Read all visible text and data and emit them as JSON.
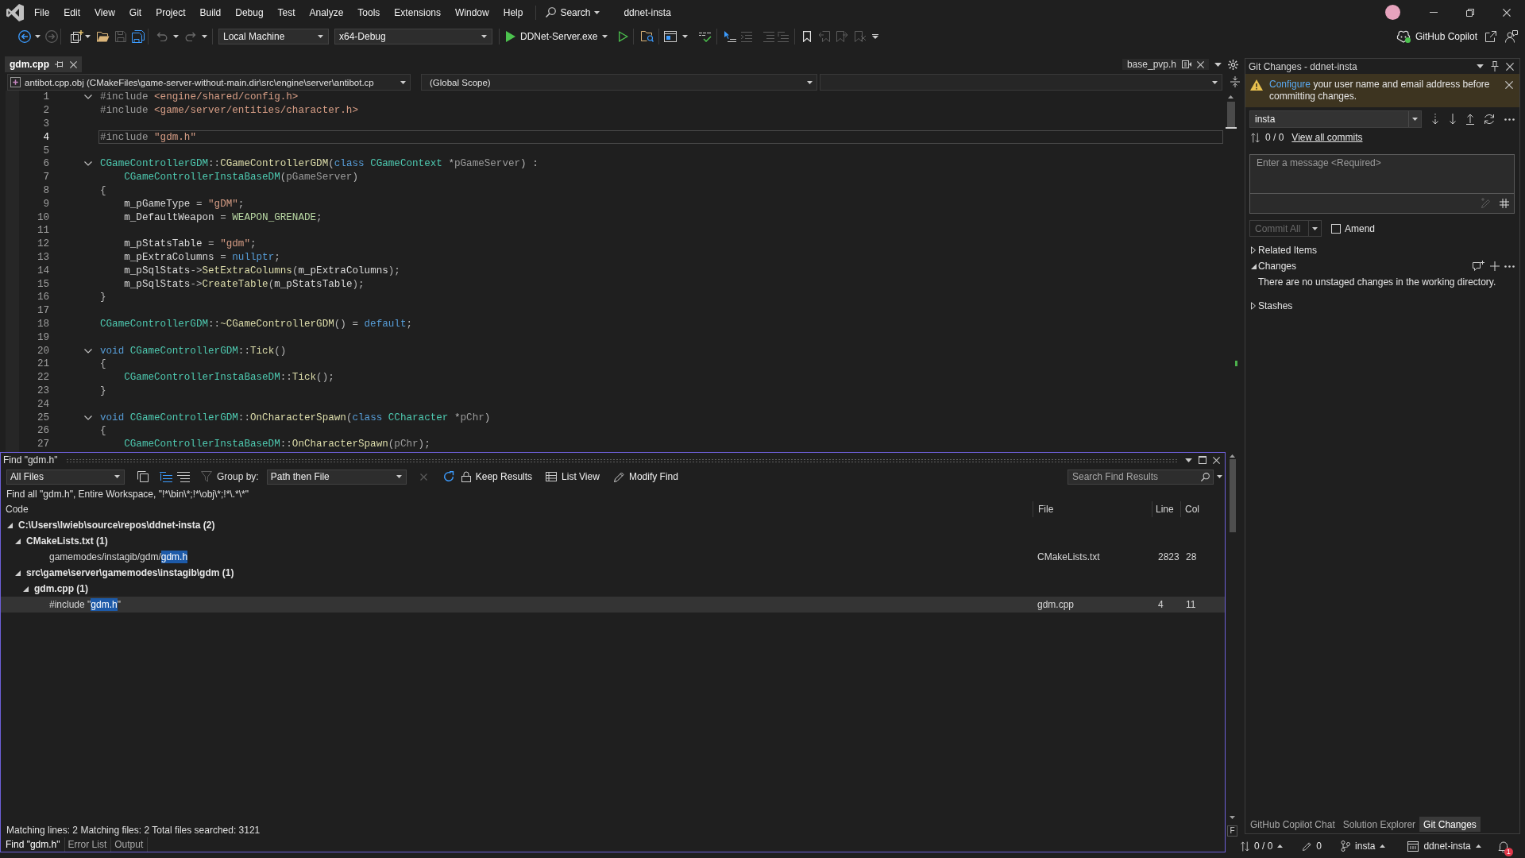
{
  "menu_bar": {
    "items": [
      "File",
      "Edit",
      "View",
      "Git",
      "Project",
      "Build",
      "Debug",
      "Test",
      "Analyze",
      "Tools",
      "Extensions",
      "Window",
      "Help"
    ],
    "search": "Search",
    "solution": "ddnet-insta"
  },
  "toolbar": {
    "target": "Local Machine",
    "configuration": "x64-Debug",
    "startup_item": "DDNet-Server.exe",
    "copilot": "GitHub Copilot"
  },
  "document_tabs": [
    {
      "label": "gdm.cpp",
      "kind": "open",
      "selected": true
    },
    {
      "label": "base_pvp.h",
      "kind": "preview",
      "selected": false
    }
  ],
  "navigation_bar": {
    "project": "antibot.cpp.obj (CMakeFiles\\game-server-without-main.dir\\src\\engine\\server\\antibot.cp",
    "scope": "(Global Scope)"
  },
  "editor": {
    "lines": [
      {
        "number": "1",
        "foldable": true,
        "current": false,
        "tokens": [
          {
            "kind": "pre",
            "text": "#include "
          },
          {
            "kind": "inc",
            "text": "<engine/shared/config.h>"
          }
        ]
      },
      {
        "number": "2",
        "foldable": false,
        "current": false,
        "tokens": [
          {
            "kind": "pre",
            "text": "#include "
          },
          {
            "kind": "inc",
            "text": "<game/server/entities/character.h>"
          }
        ]
      },
      {
        "number": "3",
        "foldable": false,
        "current": false
      },
      {
        "number": "4",
        "foldable": false,
        "current": true,
        "tokens": [
          {
            "kind": "pre",
            "text": "#include "
          },
          {
            "kind": "str",
            "text": "\"gdm.h\""
          }
        ]
      },
      {
        "number": "5",
        "foldable": false,
        "current": false
      },
      {
        "number": "6",
        "foldable": true,
        "current": false,
        "tokens": [
          {
            "kind": "type",
            "text": "CGameControllerGDM"
          },
          {
            "kind": "op",
            "text": "::"
          },
          {
            "kind": "fn",
            "text": "CGameControllerGDM"
          },
          {
            "kind": "op",
            "text": "("
          },
          {
            "kind": "kw",
            "text": "class "
          },
          {
            "kind": "type",
            "text": "CGameContext"
          },
          {
            "kind": "op",
            "text": " *"
          },
          {
            "kind": "param",
            "text": "pGameServer"
          },
          {
            "kind": "op",
            "text": ") :"
          }
        ]
      },
      {
        "number": "7",
        "foldable": false,
        "current": false,
        "tokens": [
          {
            "kind": "type",
            "text": "    CGameControllerInstaBaseDM"
          },
          {
            "kind": "op",
            "text": "("
          },
          {
            "kind": "param",
            "text": "pGameServer"
          },
          {
            "kind": "op",
            "text": ")"
          }
        ]
      },
      {
        "number": "8",
        "foldable": false,
        "current": false,
        "tokens": [
          {
            "kind": "op",
            "text": "{"
          }
        ]
      },
      {
        "number": "9",
        "foldable": false,
        "current": false,
        "tokens": [
          {
            "kind": "var",
            "text": "    m_pGameType"
          },
          {
            "kind": "op",
            "text": " = "
          },
          {
            "kind": "str",
            "text": "\"gDM\""
          },
          {
            "kind": "op",
            "text": ";"
          }
        ]
      },
      {
        "number": "10",
        "foldable": false,
        "current": false,
        "tokens": [
          {
            "kind": "var",
            "text": "    m_DefaultWeapon"
          },
          {
            "kind": "op",
            "text": " = "
          },
          {
            "kind": "enum",
            "text": "WEAPON_GRENADE"
          },
          {
            "kind": "op",
            "text": ";"
          }
        ]
      },
      {
        "number": "11",
        "foldable": false,
        "current": false
      },
      {
        "number": "12",
        "foldable": false,
        "current": false,
        "tokens": [
          {
            "kind": "var",
            "text": "    m_pStatsTable"
          },
          {
            "kind": "op",
            "text": " = "
          },
          {
            "kind": "str",
            "text": "\"gdm\""
          },
          {
            "kind": "op",
            "text": ";"
          }
        ]
      },
      {
        "number": "13",
        "foldable": false,
        "current": false,
        "tokens": [
          {
            "kind": "var",
            "text": "    m_pExtraColumns"
          },
          {
            "kind": "op",
            "text": " = "
          },
          {
            "kind": "kw",
            "text": "nullptr"
          },
          {
            "kind": "op",
            "text": ";"
          }
        ]
      },
      {
        "number": "14",
        "foldable": false,
        "current": false,
        "tokens": [
          {
            "kind": "var",
            "text": "    m_pSqlStats"
          },
          {
            "kind": "op",
            "text": "->"
          },
          {
            "kind": "fn",
            "text": "SetExtraColumns"
          },
          {
            "kind": "op",
            "text": "("
          },
          {
            "kind": "var",
            "text": "m_pExtraColumns"
          },
          {
            "kind": "op",
            "text": ");"
          }
        ]
      },
      {
        "number": "15",
        "foldable": false,
        "current": false,
        "tokens": [
          {
            "kind": "var",
            "text": "    m_pSqlStats"
          },
          {
            "kind": "op",
            "text": "->"
          },
          {
            "kind": "fn",
            "text": "CreateTable"
          },
          {
            "kind": "op",
            "text": "("
          },
          {
            "kind": "var",
            "text": "m_pStatsTable"
          },
          {
            "kind": "op",
            "text": ");"
          }
        ]
      },
      {
        "number": "16",
        "foldable": false,
        "current": false,
        "tokens": [
          {
            "kind": "op",
            "text": "}"
          }
        ]
      },
      {
        "number": "17",
        "foldable": false,
        "current": false
      },
      {
        "number": "18",
        "foldable": false,
        "current": false,
        "tokens": [
          {
            "kind": "type",
            "text": "CGameControllerGDM"
          },
          {
            "kind": "op",
            "text": "::"
          },
          {
            "kind": "fn",
            "text": "~CGameControllerGDM"
          },
          {
            "kind": "op",
            "text": "() = "
          },
          {
            "kind": "kw",
            "text": "default"
          },
          {
            "kind": "op",
            "text": ";"
          }
        ]
      },
      {
        "number": "19",
        "foldable": false,
        "current": false
      },
      {
        "number": "20",
        "foldable": true,
        "current": false,
        "tokens": [
          {
            "kind": "kw",
            "text": "void "
          },
          {
            "kind": "type",
            "text": "CGameControllerGDM"
          },
          {
            "kind": "op",
            "text": "::"
          },
          {
            "kind": "fn",
            "text": "Tick"
          },
          {
            "kind": "op",
            "text": "()"
          }
        ]
      },
      {
        "number": "21",
        "foldable": false,
        "current": false,
        "tokens": [
          {
            "kind": "op",
            "text": "{"
          }
        ]
      },
      {
        "number": "22",
        "foldable": false,
        "current": false,
        "tokens": [
          {
            "kind": "type",
            "text": "    CGameControllerInstaBaseDM"
          },
          {
            "kind": "op",
            "text": "::"
          },
          {
            "kind": "fn",
            "text": "Tick"
          },
          {
            "kind": "op",
            "text": "();"
          }
        ]
      },
      {
        "number": "23",
        "foldable": false,
        "current": false,
        "tokens": [
          {
            "kind": "op",
            "text": "}"
          }
        ]
      },
      {
        "number": "24",
        "foldable": false,
        "current": false
      },
      {
        "number": "25",
        "foldable": true,
        "current": false,
        "tokens": [
          {
            "kind": "kw",
            "text": "void "
          },
          {
            "kind": "type",
            "text": "CGameControllerGDM"
          },
          {
            "kind": "op",
            "text": "::"
          },
          {
            "kind": "fn",
            "text": "OnCharacterSpawn"
          },
          {
            "kind": "op",
            "text": "("
          },
          {
            "kind": "kw",
            "text": "class "
          },
          {
            "kind": "type",
            "text": "CCharacter"
          },
          {
            "kind": "op",
            "text": " *"
          },
          {
            "kind": "param",
            "text": "pChr"
          },
          {
            "kind": "op",
            "text": ")"
          }
        ]
      },
      {
        "number": "26",
        "foldable": false,
        "current": false,
        "tokens": [
          {
            "kind": "op",
            "text": "{"
          }
        ]
      },
      {
        "number": "27",
        "foldable": false,
        "current": false,
        "tokens": [
          {
            "kind": "type",
            "text": "    CGameControllerInstaBaseDM"
          },
          {
            "kind": "op",
            "text": "::"
          },
          {
            "kind": "fn",
            "text": "OnCharacterSpawn"
          },
          {
            "kind": "op",
            "text": "("
          },
          {
            "kind": "param",
            "text": "pChr"
          },
          {
            "kind": "op",
            "text": ");"
          }
        ]
      }
    ]
  },
  "find_results": {
    "title": "Find \"gdm.h\"",
    "scope": "All Files",
    "group_by_label": "Group by:",
    "group_by": "Path then File",
    "actions": [
      "Keep Results",
      "List View",
      "Modify Find"
    ],
    "search_placeholder": "Search Find Results",
    "query": "Find all \"gdm.h\", Entire Workspace, \"!*\\bin\\*;!*\\obj\\*;!*\\.*\\*\"",
    "columns": [
      "Code",
      "File",
      "Line",
      "Col"
    ],
    "tree": [
      {
        "kind": "group",
        "label": "C:\\Users\\lwieb\\source\\repos\\ddnet-insta (2)",
        "expanded": true,
        "selected": false,
        "children": [
          {
            "kind": "group",
            "label": "CMakeLists.txt (1)",
            "expanded": true,
            "selected": false,
            "children": [
              {
                "kind": "match",
                "before": "gamemodes/instagib/gdm/",
                "match": "gdm.h",
                "file": "CMakeLists.txt",
                "line": "2823",
                "col": "28",
                "selected": false
              }
            ]
          },
          {
            "kind": "group",
            "label": "src\\game\\server\\gamemodes\\instagib\\gdm (1)",
            "expanded": true,
            "selected": false,
            "children": [
              {
                "kind": "group",
                "label": "gdm.cpp (1)",
                "expanded": true,
                "selected": false,
                "children": [
                  {
                    "kind": "match",
                    "before": "#include \"",
                    "match": "gdm.h",
                    "after": "\"",
                    "file": "gdm.cpp",
                    "line": "4",
                    "col": "11",
                    "selected": true
                  }
                ]
              }
            ]
          }
        ]
      }
    ],
    "status": "Matching lines: 2 Matching files: 2 Total files searched: 3121",
    "scroll_marker": "F",
    "panel_tabs": [
      {
        "label": "Find \"gdm.h\"",
        "selected": true
      },
      {
        "label": "Error List",
        "selected": false
      },
      {
        "label": "Output",
        "selected": false
      }
    ]
  },
  "git_changes": {
    "title": "Git Changes - ddnet-insta",
    "notice": {
      "link": "Configure",
      "text": "your user name and email address before committing changes."
    },
    "branch": "insta",
    "commits": "0 / 0",
    "commits_link": "View all commits",
    "message_placeholder": "Enter a message <Required>",
    "commit_button": {
      "label": "Commit All",
      "disabled": true
    },
    "amend": {
      "label": "Amend",
      "checked": false
    },
    "sections": [
      {
        "kind": "related",
        "label": "Related Items",
        "expanded": false
      },
      {
        "kind": "changes",
        "label": "Changes",
        "expanded": true,
        "text": "There are no unstaged changes in the working directory."
      },
      {
        "kind": "stashes",
        "label": "Stashes",
        "expanded": false
      }
    ],
    "tool_tabs": [
      {
        "label": "GitHub Copilot Chat",
        "selected": false
      },
      {
        "label": "Solution Explorer",
        "selected": false
      },
      {
        "label": "Git Changes",
        "selected": true
      }
    ]
  },
  "status_bar": {
    "commits": "0 / 0",
    "changes": "0",
    "branch": "insta",
    "repository": "ddnet-insta",
    "notifications": "1"
  }
}
